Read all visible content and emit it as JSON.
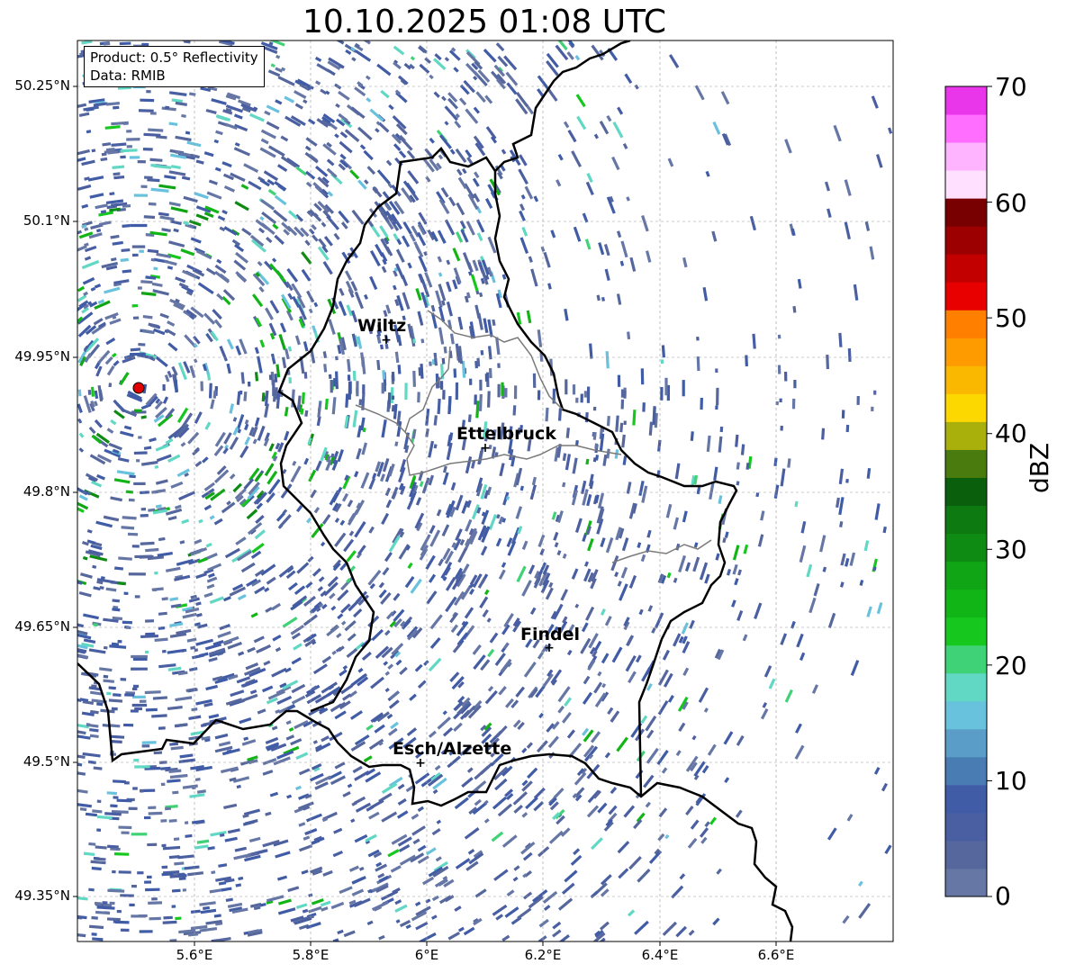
{
  "title": "10.10.2025 01:08 UTC",
  "info_box": {
    "product": "Product: 0.5° Reflectivity",
    "data": "Data: RMIB"
  },
  "axes": {
    "lat_labels": [
      "50.25°N",
      "50.1°N",
      "49.95°N",
      "49.8°N",
      "49.65°N",
      "49.5°N",
      "49.35°N"
    ],
    "lon_labels": [
      "5.6°E",
      "5.8°E",
      "6°E",
      "6.2°E",
      "6.4°E",
      "6.6°E"
    ],
    "gridlines": true
  },
  "cities": [
    {
      "name": "Wiltz"
    },
    {
      "name": "Ettelbruck"
    },
    {
      "name": "Findel"
    },
    {
      "name": "Esch/Alzette"
    }
  ],
  "radar_site": {
    "marker_color": "#e00000"
  },
  "colorbar": {
    "label": "dBZ",
    "ticks": [
      "0",
      "10",
      "20",
      "30",
      "40",
      "50",
      "60",
      "70"
    ],
    "colors": [
      "#6677a6",
      "#56679e",
      "#4a5fa2",
      "#415ca6",
      "#4a7cb4",
      "#5a9dc8",
      "#68c2dd",
      "#60d8c3",
      "#3fd276",
      "#16c81d",
      "#12b516",
      "#0fa515",
      "#0e8b12",
      "#0c7a10",
      "#0a5f0d",
      "#497b0f",
      "#a9b00b",
      "#fdd700",
      "#fbb800",
      "#fd9b00",
      "#ff7f00",
      "#e80000",
      "#c30000",
      "#9d0000",
      "#780000",
      "#ffe0ff",
      "#ffb4ff",
      "#ff6eff",
      "#ea36ea"
    ]
  }
}
